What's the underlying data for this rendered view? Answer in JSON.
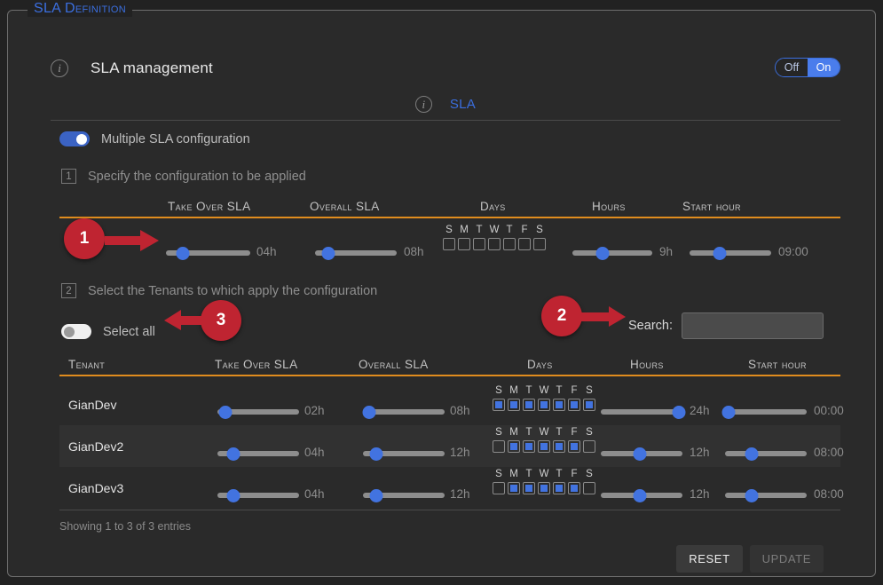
{
  "panel": {
    "legend": "SLA Definition"
  },
  "header": {
    "info_icon": "info-icon",
    "title": "SLA management",
    "onoff": {
      "off_label": "Off",
      "on_label": "On",
      "state": "On"
    }
  },
  "tab": {
    "info_icon": "info-icon",
    "label": "SLA"
  },
  "multiple_sla": {
    "label": "Multiple SLA configuration",
    "state": "on"
  },
  "step1": {
    "number": "1",
    "label": "Specify the configuration to be applied"
  },
  "step2": {
    "number": "2",
    "label": "Select the Tenants to which apply the configuration"
  },
  "config_headers": {
    "take_over": "Take Over SLA",
    "overall": "Overall SLA",
    "days": "Days",
    "hours": "Hours",
    "start_hour": "Start hour"
  },
  "day_labels": [
    "S",
    "M",
    "T",
    "W",
    "T",
    "F",
    "S"
  ],
  "config_row": {
    "take_over": {
      "value": "04h",
      "pct": 20
    },
    "overall": {
      "value": "08h",
      "pct": 16
    },
    "days": [
      false,
      false,
      false,
      false,
      false,
      false,
      false
    ],
    "hours": {
      "value": "9h",
      "pct": 38
    },
    "start_hour": {
      "value": "09:00",
      "pct": 37
    }
  },
  "select_all": {
    "label": "Select all",
    "state": "off"
  },
  "search": {
    "label": "Search:",
    "value": "",
    "placeholder": ""
  },
  "table_headers": {
    "tenant": "Tenant",
    "take_over": "Take Over SLA",
    "overall": "Overall SLA",
    "days": "Days",
    "hours": "Hours",
    "start_hour": "Start hour"
  },
  "tenants": [
    {
      "name": "GianDev",
      "take_over": {
        "value": "02h",
        "pct": 10
      },
      "overall": {
        "value": "08h",
        "pct": 8
      },
      "days": [
        true,
        true,
        true,
        true,
        true,
        true,
        true
      ],
      "hours": {
        "value": "24h",
        "pct": 96
      },
      "start_hour": {
        "value": "00:00",
        "pct": 4
      }
    },
    {
      "name": "GianDev2",
      "take_over": {
        "value": "04h",
        "pct": 20
      },
      "overall": {
        "value": "12h",
        "pct": 16
      },
      "days": [
        false,
        true,
        true,
        true,
        true,
        true,
        false
      ],
      "hours": {
        "value": "12h",
        "pct": 48
      },
      "start_hour": {
        "value": "08:00",
        "pct": 33
      }
    },
    {
      "name": "GianDev3",
      "take_over": {
        "value": "04h",
        "pct": 20
      },
      "overall": {
        "value": "12h",
        "pct": 16
      },
      "days": [
        false,
        true,
        true,
        true,
        true,
        true,
        false
      ],
      "hours": {
        "value": "12h",
        "pct": 48
      },
      "start_hour": {
        "value": "08:00",
        "pct": 33
      }
    }
  ],
  "showing": "Showing 1 to 3 of 3 entries",
  "footer": {
    "reset_label": "RESET",
    "update_label": "UPDATE",
    "update_disabled": true
  },
  "annotations": [
    {
      "number": "1",
      "direction": "right"
    },
    {
      "number": "2",
      "direction": "right"
    },
    {
      "number": "3",
      "direction": "left"
    }
  ],
  "colors": {
    "accent_blue": "#3b6fe0",
    "header_rule_orange": "#e08c1e",
    "annotation_red": "#bf2431",
    "panel_bg": "#2a2a2a",
    "page_bg": "#222222"
  }
}
